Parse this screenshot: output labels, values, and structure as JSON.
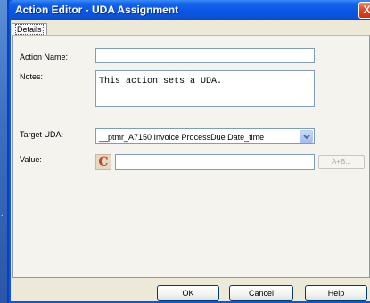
{
  "window": {
    "title": "Action Editor - UDA Assignment",
    "close_glyph": "X"
  },
  "desktop": {
    "mark": "."
  },
  "tabs": [
    {
      "label": "Details",
      "selected": true
    }
  ],
  "form": {
    "action_name": {
      "label": "Action Name:",
      "value": ""
    },
    "notes": {
      "label": "Notes:",
      "value": "This action sets a UDA."
    },
    "target_uda": {
      "label": "Target UDA:",
      "selected": "__ptmr_A7150 Invoice ProcessDue Date_time"
    },
    "value": {
      "label": "Value:",
      "icon_letter": "C",
      "input_value": "",
      "builder_label": "A+B..."
    }
  },
  "buttons": {
    "ok": "OK",
    "cancel": "Cancel",
    "help": "Help"
  },
  "icons": {
    "close": "close-icon",
    "dropdown": "chevron-down-icon",
    "constant": "constant-c-icon"
  },
  "colors": {
    "titlebar": "#0a56e3",
    "dialog_bg": "#ece9d8",
    "panel_bg": "#f4f3ee",
    "input_border": "#7f9db9",
    "c_icon_text": "#c0462a"
  }
}
